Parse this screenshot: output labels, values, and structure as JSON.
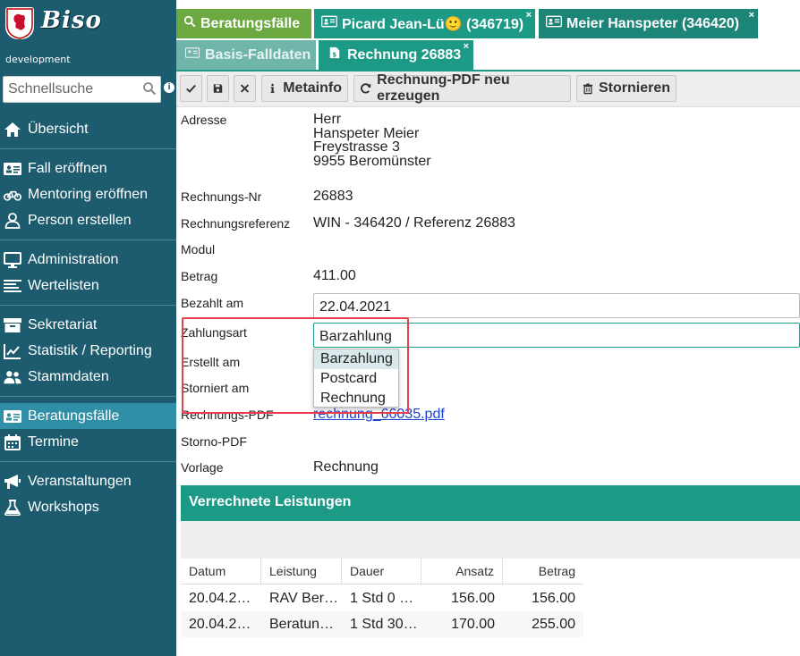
{
  "app": {
    "logo_text": "Biso",
    "environment": "development"
  },
  "search": {
    "placeholder": "Schnellsuche",
    "info": "i"
  },
  "sidebar": {
    "groups": [
      [
        {
          "label": "Übersicht",
          "icon": "home-icon"
        }
      ],
      [
        {
          "label": "Fall eröffnen",
          "icon": "id-card-icon"
        },
        {
          "label": "Mentoring eröffnen",
          "icon": "bicycle-icon"
        },
        {
          "label": "Person erstellen",
          "icon": "user-icon"
        }
      ],
      [
        {
          "label": "Administration",
          "icon": "monitor-icon"
        },
        {
          "label": "Wertelisten",
          "icon": "list-icon"
        }
      ],
      [
        {
          "label": "Sekretariat",
          "icon": "archive-icon"
        },
        {
          "label": "Statistik / Reporting",
          "icon": "chart-line-icon"
        },
        {
          "label": "Stammdaten",
          "icon": "users-icon"
        }
      ],
      [
        {
          "label": "Beratungsfälle",
          "icon": "id-card-icon",
          "active": true
        },
        {
          "label": "Termine",
          "icon": "calendar-icon"
        }
      ],
      [
        {
          "label": "Veranstaltungen",
          "icon": "megaphone-icon"
        },
        {
          "label": "Workshops",
          "icon": "flask-icon"
        }
      ]
    ]
  },
  "tabs": {
    "main": "Beratungsfälle",
    "picard": "Picard Jean-Lü🙂 (346719)",
    "meier": "Meier Hanspeter (346420)",
    "close": "×"
  },
  "subtabs": {
    "basis": "Basis-Falldaten",
    "rechnung": "Rechnung 26883",
    "close": "×"
  },
  "toolbar": {
    "metainfo": "Metainfo",
    "pdf": "Rechnung-PDF neu erzeugen",
    "stornieren": "Stornieren"
  },
  "form": {
    "adresse_label": "Adresse",
    "adresse": [
      "Herr",
      "Hanspeter Meier",
      "Freystrasse 3",
      "9955 Beromünster"
    ],
    "rnr_label": "Rechnungs-Nr",
    "rnr": "26883",
    "ref_label": "Rechnungsreferenz",
    "ref": "WIN - 346420 / Referenz 26883",
    "modul_label": "Modul",
    "betrag_label": "Betrag",
    "betrag": "411.00",
    "bezahlt_label": "Bezahlt am",
    "bezahlt": "22.04.2021",
    "zahlungsart_label": "Zahlungsart",
    "zahlungsart": "Barzahlung",
    "zahlungsart_options": [
      "Barzahlung",
      "Postcard",
      "Rechnung"
    ],
    "erstellt_label": "Erstellt am",
    "storniert_label": "Storniert am",
    "pdf_label": "Rechnungs-PDF",
    "pdf_link": "rechnung_66035.pdf",
    "storno_label": "Storno-PDF",
    "vorlage_label": "Vorlage",
    "vorlage": "Rechnung"
  },
  "leistungen": {
    "title": "Verrechnete Leistungen",
    "columns": [
      "Datum",
      "Leistung",
      "Dauer",
      "Ansatz",
      "Betrag"
    ],
    "rows": [
      [
        "20.04.2…",
        "RAV Ber…",
        "1 Std 0 …",
        "156.00",
        "156.00"
      ],
      [
        "20.04.2…",
        "Beratun…",
        "1 Std 30…",
        "170.00",
        "255.00"
      ]
    ]
  },
  "colors": {
    "sidebar": "#1d5c6e",
    "sidebar_active": "#2e8fa6",
    "accent_teal": "#1d9a85",
    "tab_green": "#6da941",
    "highlight_red": "#e8404a"
  }
}
